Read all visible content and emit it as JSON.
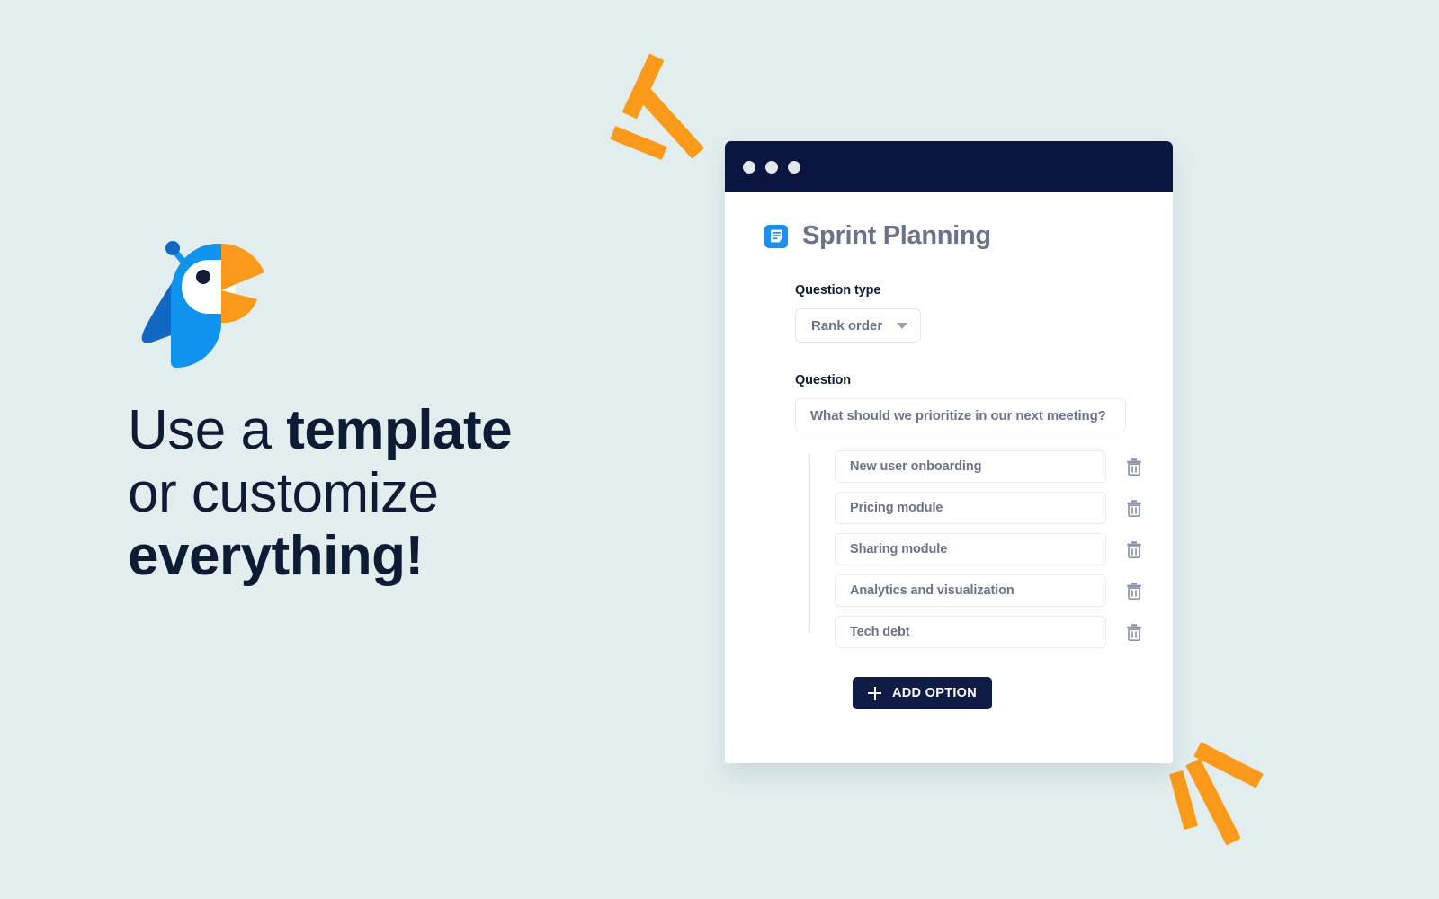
{
  "theme": {
    "background": "#e2eeee",
    "navy": "#0b1640",
    "orange": "#fb9a1a",
    "blue": "#1a91f0",
    "muted_text": "#6b7389"
  },
  "promo": {
    "logo_icon": "parrot-logo",
    "headline_lines": [
      {
        "plain": "Use a ",
        "strong": "template"
      },
      {
        "plain": "or customize",
        "strong": ""
      },
      {
        "plain": "",
        "strong": "everything!"
      }
    ]
  },
  "decorations": {
    "top_left_sparks": 3,
    "bottom_right_sparks": 3,
    "shape": "orange-bar"
  },
  "window": {
    "titlebar": {
      "dots": [
        "window-dot",
        "window-dot",
        "window-dot"
      ]
    },
    "document": {
      "icon": "form-document-icon",
      "title": "Sprint Planning"
    },
    "question_type": {
      "label": "Question type",
      "selected": "Rank order",
      "caret_icon": "chevron-down-icon"
    },
    "question": {
      "label": "Question",
      "value": "What should we prioritize in our next meeting?",
      "options": [
        {
          "value": "New user onboarding",
          "delete_icon": "trash-icon"
        },
        {
          "value": "Pricing module",
          "delete_icon": "trash-icon"
        },
        {
          "value": "Sharing module",
          "delete_icon": "trash-icon"
        },
        {
          "value": "Analytics and visualization",
          "delete_icon": "trash-icon"
        },
        {
          "value": "Tech debt",
          "delete_icon": "trash-icon"
        }
      ]
    },
    "add_option": {
      "label": "ADD OPTION",
      "icon": "plus-icon"
    }
  }
}
